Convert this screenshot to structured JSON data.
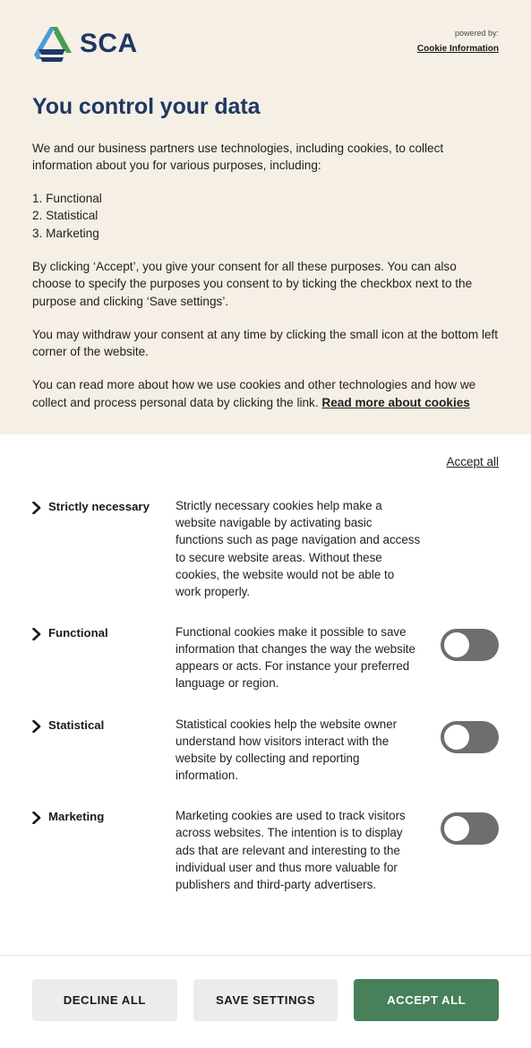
{
  "brand": {
    "logo_icon": "sca-triangle-logo",
    "name": "SCA",
    "powered_label": "powered by:",
    "powered_name": "Cookie Information",
    "logo_colors": {
      "blue": "#4A9BD8",
      "green": "#4B9B53",
      "navy": "#1F3864"
    }
  },
  "intro": {
    "headline": "You control your data",
    "paragraph_1": "We and our business partners use technologies, including cookies, to collect information about you for various purposes, including:",
    "purposes": [
      "1. Functional",
      "2. Statistical",
      "3. Marketing"
    ],
    "paragraph_2": "By clicking ‘Accept’, you give your consent for all these purposes. You can also choose to specify the purposes you consent to by ticking the checkbox next to the purpose and clicking ‘Save settings’.",
    "paragraph_3": "You may withdraw your consent at any time by clicking the small icon at the bottom left corner of the website.",
    "paragraph_4": "You can read more about how we use cookies and other technologies and how we collect and process personal data by clicking the link.",
    "read_more_link": "Read more about cookies"
  },
  "accept_all_link": "Accept all",
  "categories": [
    {
      "name": "Strictly necessary",
      "description": "Strictly necessary cookies help make a website navigable by activating basic functions such as page navigation and access to secure website areas. Without these cookies, the website would not be able to work properly.",
      "has_toggle": false,
      "toggle_state": "none",
      "expand_icon": "chevron-right-icon"
    },
    {
      "name": "Functional",
      "description": "Functional cookies make it possible to save information that changes the way the website appears or acts. For instance your preferred language or region.",
      "has_toggle": true,
      "toggle_state": "off",
      "expand_icon": "chevron-right-icon"
    },
    {
      "name": "Statistical",
      "description": "Statistical cookies help the website owner understand how visitors interact with the website by collecting and reporting information.",
      "has_toggle": true,
      "toggle_state": "off",
      "expand_icon": "chevron-right-icon"
    },
    {
      "name": "Marketing",
      "description": "Marketing cookies are used to track visitors across websites. The intention is to display ads that are relevant and interesting to the individual user and thus more valuable for publishers and third-party advertisers.",
      "has_toggle": true,
      "toggle_state": "off",
      "expand_icon": "chevron-right-icon"
    }
  ],
  "footer": {
    "decline_all": "DECLINE ALL",
    "save_settings": "SAVE SETTINGS",
    "accept_all": "ACCEPT ALL",
    "primary_color": "#478059",
    "secondary_color": "#ECECEC"
  },
  "theme": {
    "intro_background": "#F6EFE5",
    "heading_color": "#1F3864",
    "body_background": "#FFFFFF",
    "toggle_off_color": "#6E6E6E"
  }
}
